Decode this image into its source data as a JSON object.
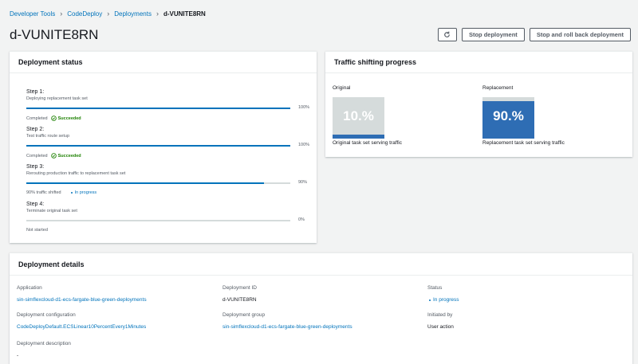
{
  "breadcrumb": {
    "items": [
      "Developer Tools",
      "CodeDeploy",
      "Deployments"
    ],
    "current": "d-VUNITE8RN"
  },
  "page_title": "d-VUNITE8RN",
  "actions": {
    "refresh_icon": "refresh-icon",
    "stop": "Stop deployment",
    "stop_rollback": "Stop and roll back deployment"
  },
  "status_panel": {
    "title": "Deployment status",
    "steps": [
      {
        "title": "Step 1:",
        "desc": "Deploying replacement task set",
        "progress": 100,
        "pct": "100%",
        "status": "Completed",
        "badge": "Succeeded"
      },
      {
        "title": "Step 2:",
        "desc": "Test traffic route setup",
        "progress": 100,
        "pct": "100%",
        "status": "Completed",
        "badge": "Succeeded"
      },
      {
        "title": "Step 3:",
        "desc": "Rerouting production traffic to replacement task set",
        "progress": 90,
        "pct": "90%",
        "status": "90% traffic shifted",
        "badge": "In progress"
      },
      {
        "title": "Step 4:",
        "desc": "Terminate original task set",
        "progress": 0,
        "pct": "0%",
        "status": "Not started",
        "badge": ""
      }
    ]
  },
  "traffic_panel": {
    "title": "Traffic shifting progress",
    "original": {
      "label": "Original",
      "value": "10.%",
      "fraction": 0.1,
      "caption": "Original task set serving traffic"
    },
    "replacement": {
      "label": "Replacement",
      "value": "90.%",
      "fraction": 0.9,
      "caption": "Replacement task set serving traffic"
    }
  },
  "details_panel": {
    "title": "Deployment details",
    "application_label": "Application",
    "application_value": "sin-simflexcloud-d1-ecs-fargate-blue-green-deployments",
    "deployment_id_label": "Deployment ID",
    "deployment_id_value": "d-VUNITE8RN",
    "status_label": "Status",
    "status_value": "In progress",
    "config_label": "Deployment configuration",
    "config_value": "CodeDeployDefault.ECSLinear10PercentEvery1Minutes",
    "group_label": "Deployment group",
    "group_value": "sin-simflexcloud-d1-ecs-fargate-blue-green-deployments",
    "initiated_label": "Initiated by",
    "initiated_value": "User action",
    "description_label": "Deployment description",
    "description_value": "-"
  },
  "colors": {
    "link": "#0073bb",
    "success": "#1d8102",
    "bar": "#0073bb",
    "traffic_fill": "#2e6db4"
  }
}
